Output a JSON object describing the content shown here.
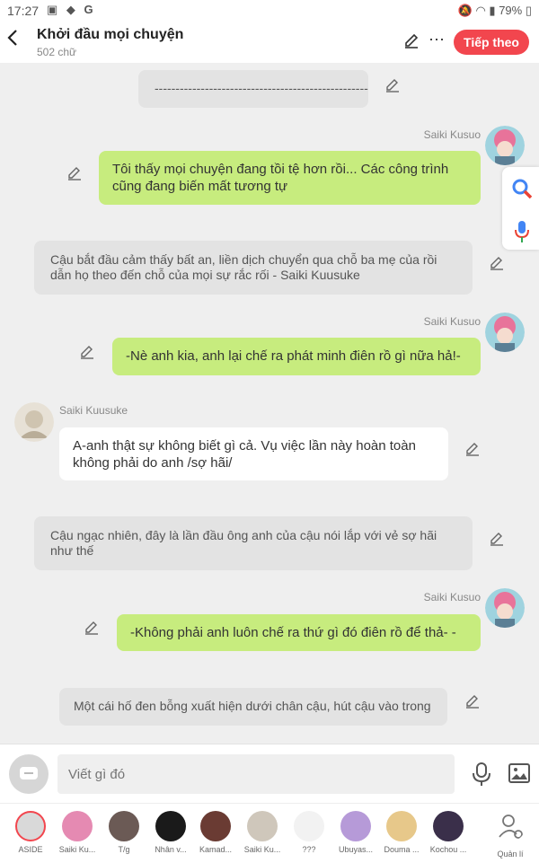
{
  "status_bar": {
    "time": "17:27",
    "battery": "79%"
  },
  "header": {
    "title": "Khởi đầu mọi chuyện",
    "word_count": "502 chữ",
    "follow_label": "Tiếp theo"
  },
  "messages": [
    {
      "type": "narration",
      "text": "-----------------------------------------------------"
    },
    {
      "type": "right",
      "name": "Saiki Kusuo",
      "text": "Tôi thấy mọi chuyện đang tồi tệ hơn rồi... Các công trình cũng đang biến mất tương tự"
    },
    {
      "type": "narration",
      "text": "Cậu bắt đầu cảm thấy bất an, liền dịch chuyển qua chỗ ba mẹ của rồi dẫn họ theo đến chỗ của mọi sự rắc rối - Saiki Kuusuke"
    },
    {
      "type": "right",
      "name": "Saiki Kusuo",
      "text": "-Nè anh kia, anh lại chế ra phát minh điên rồ gì nữa hả!-"
    },
    {
      "type": "left",
      "name": "Saiki Kuusuke",
      "text": "A-anh thật sự không biết gì cả. Vụ việc lần này hoàn toàn không phải do anh /sợ hãi/"
    },
    {
      "type": "narration",
      "text": "Cậu ngạc nhiên, đây là lần đầu ông anh của cậu nói lắp với vẻ sợ hãi như thế"
    },
    {
      "type": "right",
      "name": "Saiki Kusuo",
      "text": "-Không phải anh luôn chế ra thứ gì đó điên rồ để thả- -"
    },
    {
      "type": "narration",
      "text": "Một cái hố đen bỗng xuất hiện dưới chân cậu, hút cậu vào trong"
    }
  ],
  "composer": {
    "placeholder": "Viết gì đó"
  },
  "characters": [
    {
      "label": "ASIDE",
      "color": "#d9d9d9",
      "icon": "aside-icon"
    },
    {
      "label": "Saiki Ku...",
      "color": "#e58ab2"
    },
    {
      "label": "T/g",
      "color": "#6b5a55"
    },
    {
      "label": "Nhân v...",
      "color": "#1a1a1a"
    },
    {
      "label": "Kamad...",
      "color": "#6a3b33"
    },
    {
      "label": "Saiki Ku...",
      "color": "#cfc7bb"
    },
    {
      "label": "???",
      "color": "#f2f2f2"
    },
    {
      "label": "Ubuyas...",
      "color": "#b69ad8"
    },
    {
      "label": "Douma ...",
      "color": "#e7c88a"
    },
    {
      "label": "Kochou ...",
      "color": "#3a2f4a"
    },
    {
      "label": "Quản lí",
      "color": "#ffffff",
      "icon": "manage-icon"
    }
  ],
  "colors": {
    "accent": "#f2464e",
    "green_bubble": "#c7ec7e",
    "narration": "#e3e3e3"
  }
}
